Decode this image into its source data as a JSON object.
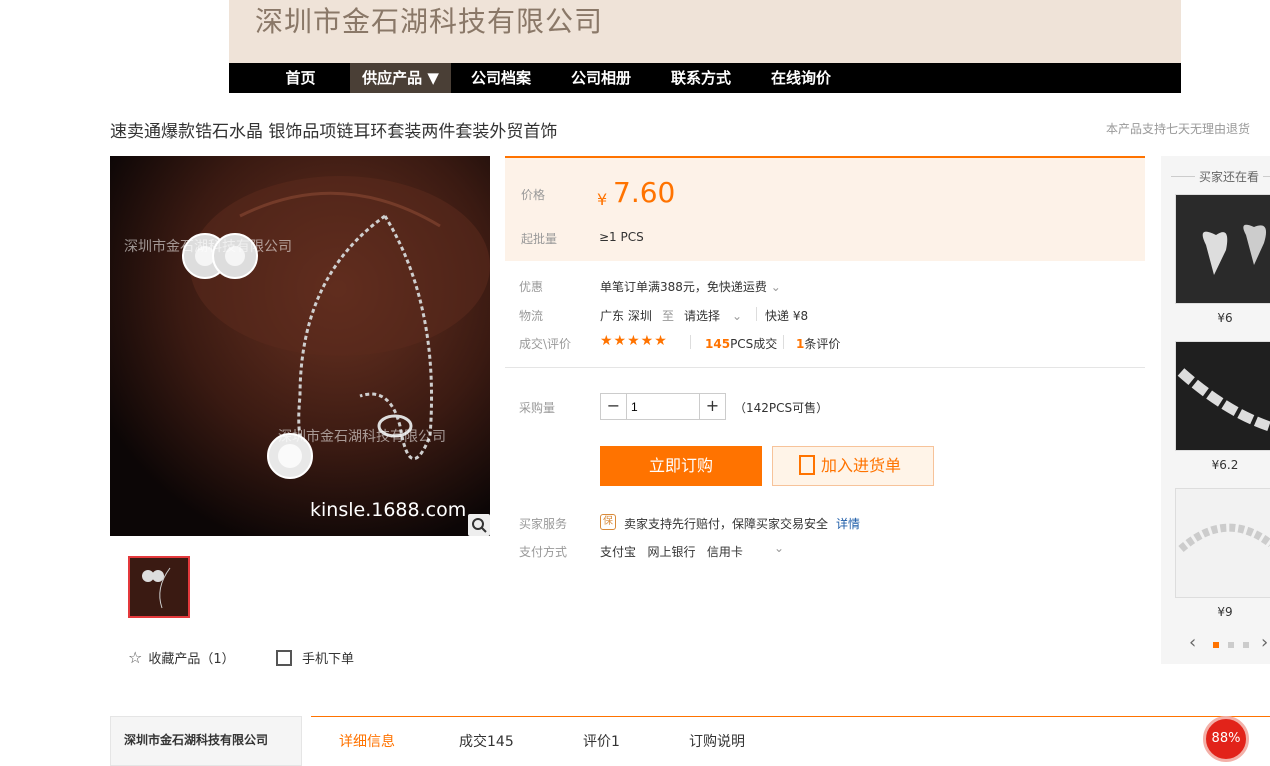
{
  "header": {
    "company_name": "深圳市金石湖科技有限公司",
    "nav": [
      "首页",
      "供应产品 ▼",
      "公司档案",
      "公司相册",
      "联系方式",
      "在线询价"
    ],
    "active_nav": "供应产品 ▼"
  },
  "product": {
    "title": "速卖通爆款锆石水晶 银饰品项链耳环套装两件套装外贸首饰",
    "return_note": "本产品支持七天无理由退货",
    "watermark_top": "深圳市金石湖科技有限公司",
    "watermark_mid": "深圳市金石湖科技有限公司",
    "watermark_url": "kinsle.1688.com"
  },
  "price": {
    "label": "价格",
    "currency": "¥",
    "value": "7.60",
    "moq_label": "起批量",
    "moq_value": "≥1  PCS"
  },
  "info": {
    "promo_label": "优惠",
    "promo_value": "单笔订单满388元，免快递运费",
    "logistics_label": "物流",
    "logistics_from": "广东 深圳",
    "logistics_to_word": "至",
    "logistics_select": "请选择",
    "logistics_express": "快递 ¥8",
    "trade_label": "成交\\评价",
    "stars": "★★★★★",
    "sold_count": "145",
    "sold_suffix": "PCS成交",
    "review_count": "1",
    "review_suffix": "条评价"
  },
  "purchase": {
    "qty_label": "采购量",
    "qty_value": "1",
    "stock_text": "（142PCS可售）",
    "buy_label": "立即订购",
    "cart_label": "加入进货单"
  },
  "service": {
    "label": "买家服务",
    "badge": "保",
    "text": "卖家支持先行赔付，保障买家交易安全",
    "link": "详情",
    "pay_label": "支付方式",
    "pay_methods": "支付宝   网上银行   信用卡"
  },
  "actions": {
    "favorite": "收藏产品（1）",
    "mobile_order": "手机下单"
  },
  "side": {
    "title": "买家还在看",
    "items": [
      {
        "price": "¥6"
      },
      {
        "price": "¥6.2"
      },
      {
        "price": "¥9"
      }
    ]
  },
  "bottom": {
    "company": "深圳市金石湖科技有限公司",
    "tabs": [
      "详细信息",
      "成交145",
      "评价1",
      "订购说明"
    ],
    "badge": "88%"
  },
  "colors": {
    "accent": "#ff7300",
    "nav_bg": "#000000",
    "banner_bg": "#efe3d8"
  }
}
